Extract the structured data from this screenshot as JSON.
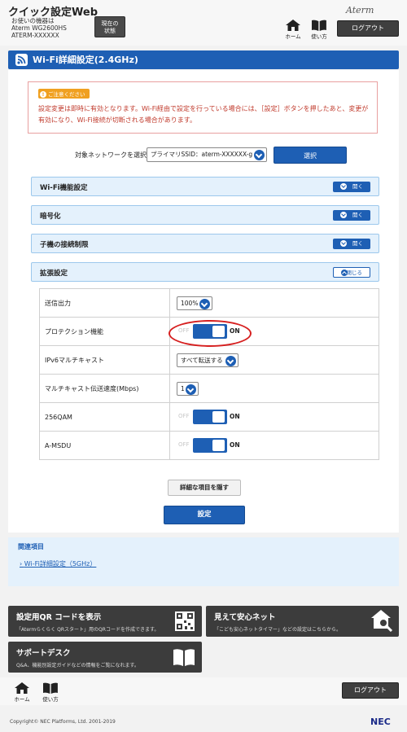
{
  "header": {
    "app_title": "クイック設定Web",
    "device_line1": "お使いの機器は",
    "device_line2": "Aterm WG2600HS",
    "device_line3": "ATERM-XXXXXX",
    "status_button_line1": "現在の",
    "status_button_line2": "状態",
    "logo": "Aterm",
    "home_label": "ホーム",
    "manual_label": "使い方",
    "logout_label": "ログアウト"
  },
  "page": {
    "title": "Wi-Fi詳細設定(2.4GHz)"
  },
  "notice": {
    "tag": "ご注意ください",
    "text": "設定変更は即時に有効となります。Wi-Fi経由で設定を行っている場合には、［設定］ボタンを押したあと、変更が有効になり、Wi-Fi接続が切断される場合があります。"
  },
  "network": {
    "label": "対象ネットワークを選択",
    "selected": "プライマリSSID：aterm-XXXXXX-g",
    "select_button": "選択"
  },
  "sections": [
    {
      "label": "Wi-Fi機能設定",
      "button": "開く"
    },
    {
      "label": "暗号化",
      "button": "開く"
    },
    {
      "label": "子機の接続制限",
      "button": "開く"
    },
    {
      "label": "拡張設定",
      "button": "閉じる"
    }
  ],
  "settings": {
    "tx_power": {
      "label": "送信出力",
      "value": "100%"
    },
    "protection": {
      "label": "プロテクション機能",
      "off": "OFF",
      "on": "ON"
    },
    "ipv6_multicast": {
      "label": "IPv6マルチキャスト",
      "value": "すべて転送する"
    },
    "multicast_rate": {
      "label": "マルチキャスト伝送速度(Mbps)",
      "value": "1"
    },
    "qam256": {
      "label": "256QAM",
      "off": "OFF",
      "on": "ON"
    },
    "amsdu": {
      "label": "A-MSDU",
      "off": "OFF",
      "on": "ON"
    }
  },
  "actions": {
    "hide_details": "詳細な項目を隠す",
    "apply": "設定"
  },
  "related": {
    "title": "関連項目",
    "link": "Wi-Fi詳細設定（5GHz）"
  },
  "banners": {
    "qr_title": "設定用QR コードを表示",
    "qr_sub": "「Atermらくらく QRスタート」用のQRコードを作成できます。",
    "safety_title": "見えて安心ネット",
    "safety_sub": "「こども安心ネットタイマー」などの設定はこちらから。",
    "support_title": "サポートデスク",
    "support_sub": "Q&A、機能別設定ガイドなどの情報をご覧になれます。"
  },
  "footer": {
    "home_label": "ホーム",
    "manual_label": "使い方",
    "logout_label": "ログアウト",
    "copyright": "Copyright© NEC Platforms, Ltd. 2001-2019",
    "brand": "NEC"
  },
  "colors": {
    "primary": "#1e5fb4",
    "accordion_bg": "#e4f1fc",
    "notice_text": "#c0392b",
    "highlight_ring": "#d62020",
    "dark_banner": "#3c3c3c"
  }
}
